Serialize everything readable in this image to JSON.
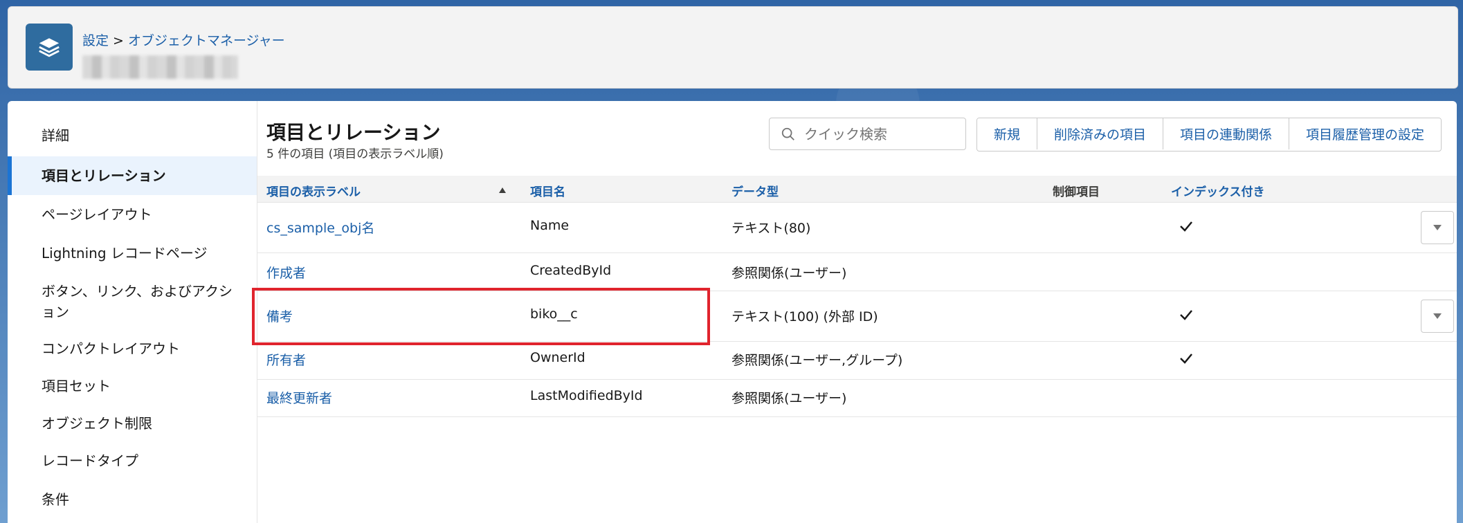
{
  "header": {
    "breadcrumb": {
      "setup": "設定",
      "separator": ">",
      "object_manager": "オブジェクトマネージャー"
    }
  },
  "sidebar": {
    "items": [
      {
        "label": "詳細"
      },
      {
        "label": "項目とリレーション",
        "active": true
      },
      {
        "label": "ページレイアウト"
      },
      {
        "label": "Lightning レコードページ"
      },
      {
        "label": "ボタン、リンク、およびアクション"
      },
      {
        "label": "コンパクトレイアウト"
      },
      {
        "label": "項目セット"
      },
      {
        "label": "オブジェクト制限"
      },
      {
        "label": "レコードタイプ"
      },
      {
        "label": "条件"
      }
    ]
  },
  "main": {
    "title": "項目とリレーション",
    "subtitle": "5 件の項目 (項目の表示ラベル順)",
    "search": {
      "placeholder": "クイック検索"
    },
    "buttons": {
      "new": "新規",
      "deleted": "削除済みの項目",
      "dependencies": "項目の連動関係",
      "history": "項目履歴管理の設定"
    },
    "columns": {
      "label": "項目の表示ラベル",
      "name": "項目名",
      "type": "データ型",
      "controlling": "制御項目",
      "indexed": "インデックス付き"
    },
    "rows": [
      {
        "label": "cs_sample_obj名",
        "name": "Name",
        "type": "テキスト(80)",
        "indexed": true,
        "menu": true
      },
      {
        "label": "作成者",
        "name": "CreatedById",
        "type": "参照関係(ユーザー)",
        "indexed": false,
        "menu": false
      },
      {
        "label": "備考",
        "name": "biko__c",
        "type": "テキスト(100) (外部 ID)",
        "indexed": true,
        "menu": true
      },
      {
        "label": "所有者",
        "name": "OwnerId",
        "type": "参照関係(ユーザー,グループ)",
        "indexed": true,
        "menu": false
      },
      {
        "label": "最終更新者",
        "name": "LastModifiedById",
        "type": "参照関係(ユーザー)",
        "indexed": false,
        "menu": false
      }
    ]
  },
  "colors": {
    "accent": "#1b5fa8",
    "highlight": "#e0242d",
    "active_bg": "#eaf3fd"
  }
}
